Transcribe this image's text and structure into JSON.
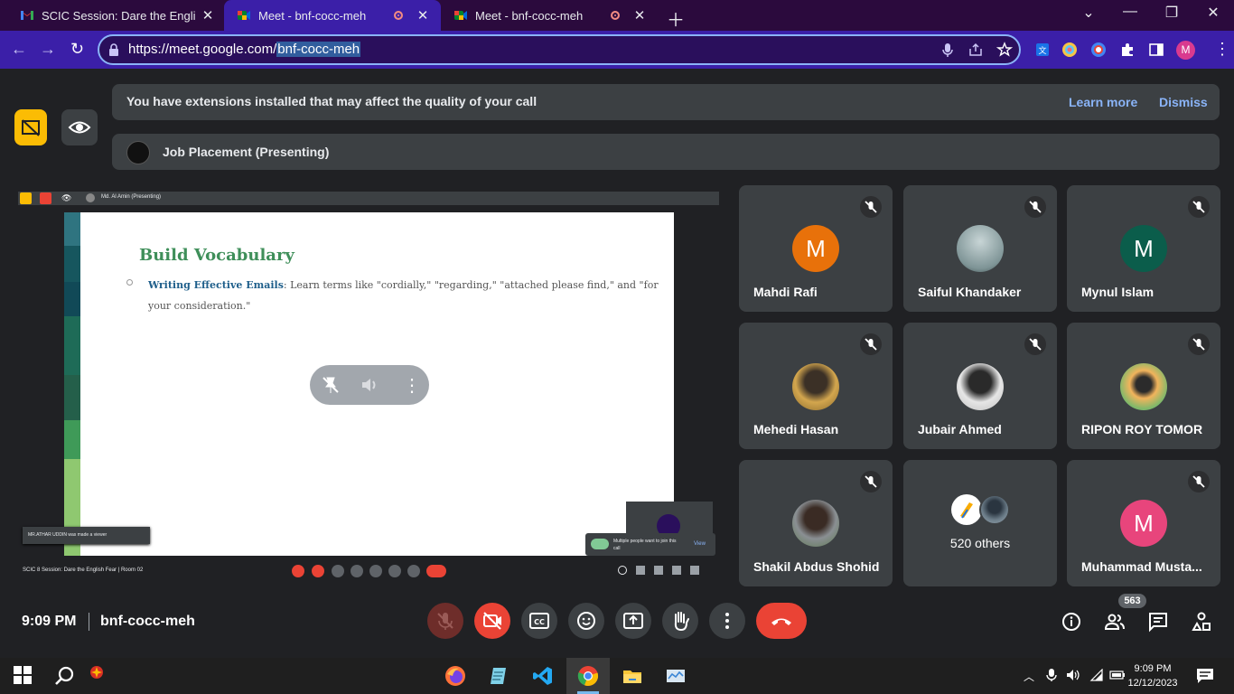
{
  "browser": {
    "tabs": [
      {
        "title": "SCIC Session: Dare the English Fe",
        "favicon": "gmail-icon",
        "active": false
      },
      {
        "title": "Meet - bnf-cocc-meh",
        "favicon": "meet-icon",
        "active": true
      },
      {
        "title": "Meet - bnf-cocc-meh",
        "favicon": "meet-icon",
        "active": false
      }
    ],
    "url_prefix": "https://meet.google.com/",
    "url_selected": "bnf-cocc-meh",
    "profile_initial": "M"
  },
  "banner": {
    "message": "You have extensions installed that may affect the quality of your call",
    "learn_more": "Learn more",
    "dismiss": "Dismiss"
  },
  "presentation": {
    "label": "Job Placement (Presenting)",
    "inner_top_label": "Md. Al Amin (Presenting)",
    "slide_title": "Build Vocabulary",
    "slide_bullet_highlight": "Writing Effective Emails",
    "slide_bullet_text": ": Learn terms like \"cordially,\" \"regarding,\" \"attached please find,\" and \"for your consideration.\"",
    "viewer_toast": "MR.ATHAR UDDIN was made a viewer",
    "join_toast": "Multiple people want to join this call",
    "join_view": "View",
    "inner_bottom_label": "SCIC 8 Session: Dare the English Fear | Room 02"
  },
  "participants": [
    {
      "name": "Mahdi Rafi",
      "initial": "M",
      "color": "#e8710a",
      "photo": false
    },
    {
      "name": "Saiful Khandaker",
      "initial": "",
      "color": "#9fb3b5",
      "photo": true
    },
    {
      "name": "Mynul Islam",
      "initial": "M",
      "color": "#0b5d4b",
      "photo": false
    },
    {
      "name": "Mehedi Hasan",
      "initial": "",
      "color": "#c9a24a",
      "photo": true
    },
    {
      "name": "Jubair Ahmed",
      "initial": "",
      "color": "#d8d8d8",
      "photo": true
    },
    {
      "name": "RIPON ROY TOMOR",
      "initial": "",
      "color": "#8bbf6a",
      "photo": true
    },
    {
      "name": "Shakil Abdus Shohid",
      "initial": "",
      "color": "#6b8f5a",
      "photo": true
    },
    {
      "name": "520 others",
      "initial": "",
      "color": "#5f6368",
      "photo": false
    },
    {
      "name": "Muhammad Musta...",
      "initial": "M",
      "color": "#e8457c",
      "photo": false
    }
  ],
  "bottom_bar": {
    "time": "9:09 PM",
    "meeting_code": "bnf-cocc-meh",
    "participant_count": "563"
  },
  "taskbar": {
    "time": "9:09 PM",
    "date": "12/12/2023"
  }
}
